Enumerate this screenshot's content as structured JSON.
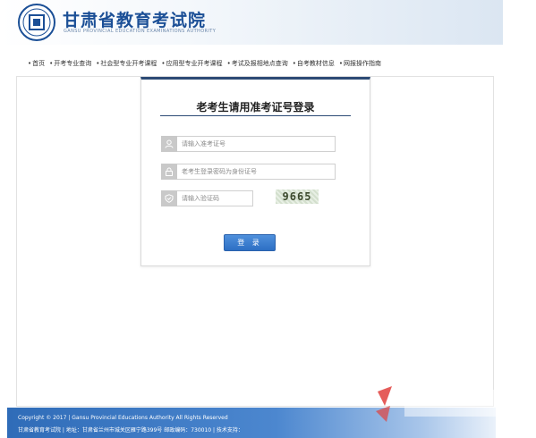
{
  "header": {
    "site_title": "甘肃省教育考试院",
    "site_subtitle": "GANSU PROVINCIAL EDUCATION EXAMINATIONS AUTHORITY",
    "logo_glyph": "国",
    "brand_color": "#1b4f96"
  },
  "nav": {
    "items": [
      "首页",
      "开考专业查询",
      "社会型专业开考课程",
      "应用型专业开考课程",
      "考试及报相地点查询",
      "自考教材信息",
      "网报操作指南"
    ]
  },
  "login": {
    "title": "老考生请用准考证号登录",
    "exam_id_placeholder": "请输入准考证号",
    "password_placeholder": "老考生登录密码为身份证号",
    "captcha_placeholder": "请输入验证码",
    "captcha_text": "9665",
    "button_label": "登 录",
    "accent_color": "#2c4a75",
    "button_color": "#3b7fd1"
  },
  "footer": {
    "copyright": "Copyright © 2017 | Gansu Provincial Educations Authority All Rights Reserved",
    "address": "甘肃省教育考试院 | 地址：甘肃省兰州市城关区雁宁路399号 邮政编码：730010 | 技术支持："
  }
}
